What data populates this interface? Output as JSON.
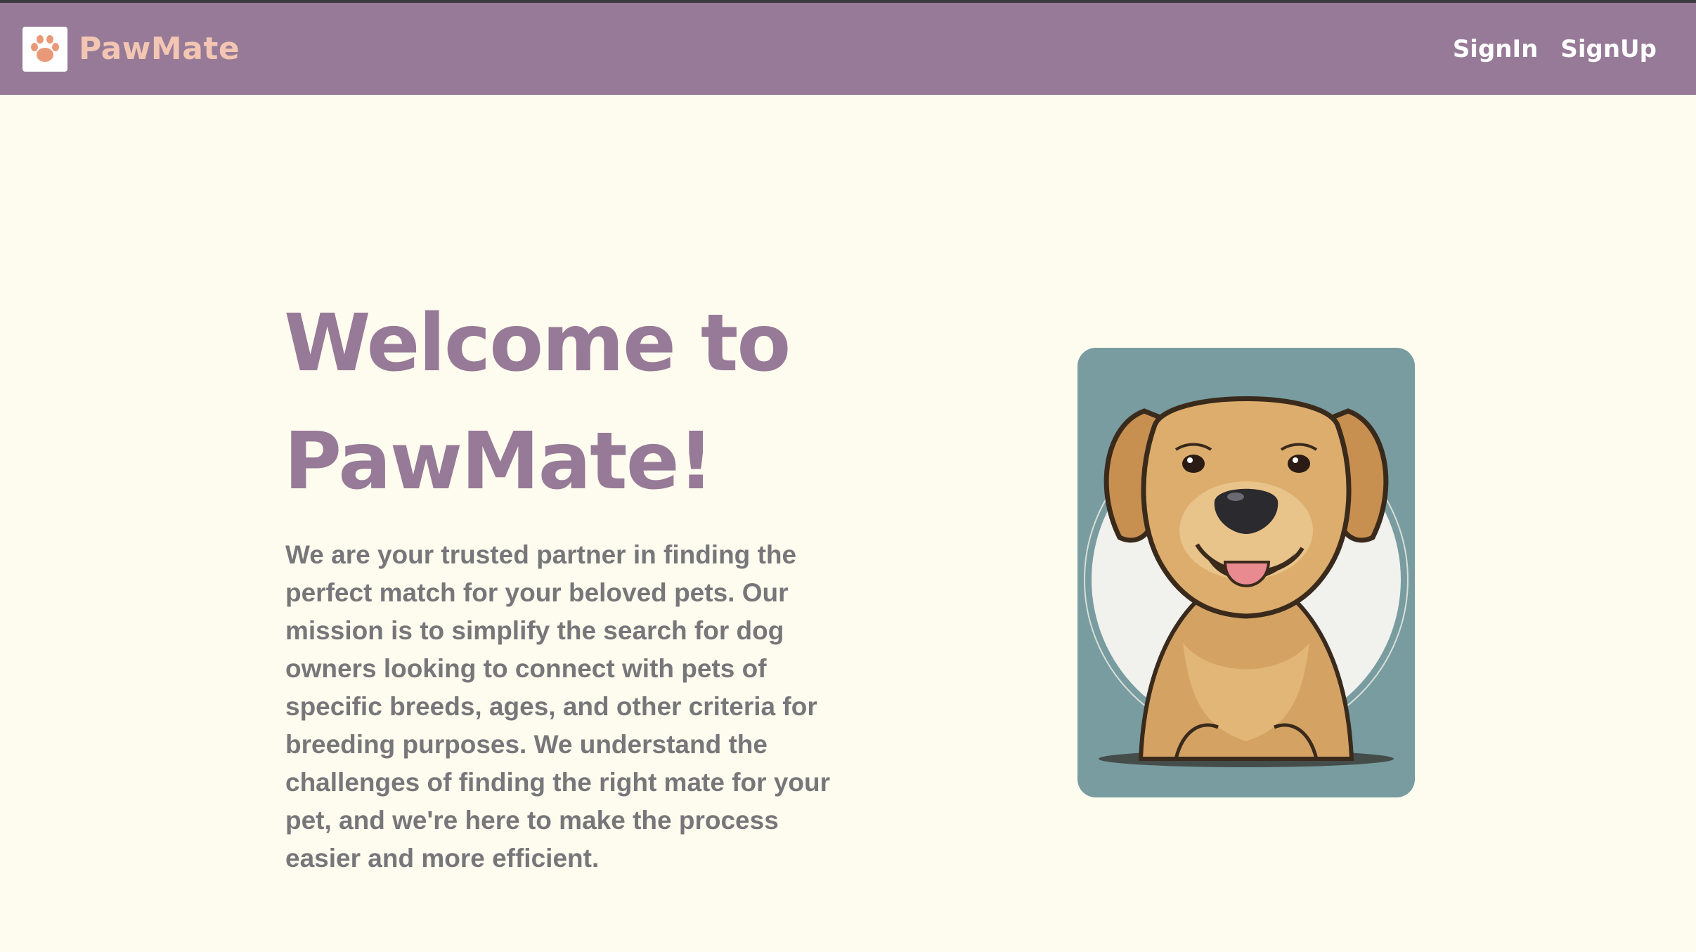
{
  "header": {
    "brand_name": "PawMate",
    "logo_icon": "paw-icon",
    "nav_links": [
      {
        "label": "SignIn"
      },
      {
        "label": "SignUp"
      }
    ]
  },
  "hero": {
    "title_line1": "Welcome to",
    "title_line2": "PawMate!",
    "description": "We are your trusted partner in finding the perfect match for your beloved pets. Our mission is to simplify the search for dog owners looking to connect with pets of specific breeds, ages, and other criteria for breeding purposes. We understand the challenges of finding the right mate for your pet, and we're here to make the process easier and more efficient.",
    "image": "golden-retriever-illustration"
  },
  "colors": {
    "navbar": "#967a97",
    "brand_text": "#f2c6b2",
    "page_background": "#fefcee",
    "title": "#967a97",
    "body_text": "#77767a",
    "card_background": "#789c9f"
  }
}
